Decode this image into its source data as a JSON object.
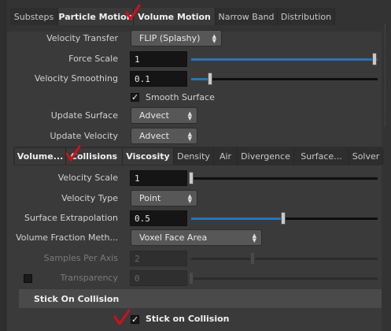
{
  "top_tabs": [
    {
      "label": "Substeps",
      "active": false
    },
    {
      "label": "Particle Motion",
      "active": true
    },
    {
      "label": "Volume Motion",
      "active": true
    },
    {
      "label": "Narrow Band",
      "active": false
    },
    {
      "label": "Distribution",
      "active": false
    }
  ],
  "particle_motion": {
    "velocity_transfer": {
      "label": "Velocity Transfer",
      "value": "FLIP (Splashy)"
    },
    "force_scale": {
      "label": "Force Scale",
      "value": "1",
      "slider_fraction": 1.0
    },
    "velocity_smoothing": {
      "label": "Velocity Smoothing",
      "value": "0.1",
      "slider_fraction": 0.1
    },
    "smooth_surface": {
      "label": "Smooth Surface",
      "checked": true
    },
    "update_surface": {
      "label": "Update Surface",
      "value": "Advect"
    },
    "update_velocity": {
      "label": "Update Velocity",
      "value": "Advect"
    }
  },
  "sub_tabs": [
    {
      "label": "Volume...",
      "active": true
    },
    {
      "label": "Collisions",
      "active": true
    },
    {
      "label": "Viscosity",
      "active": true
    },
    {
      "label": "Density",
      "active": false
    },
    {
      "label": "Air",
      "active": false
    },
    {
      "label": "Divergence",
      "active": false
    },
    {
      "label": "Surface...",
      "active": false
    },
    {
      "label": "Solver",
      "active": false
    }
  ],
  "volume_motion": {
    "velocity_scale": {
      "label": "Velocity Scale",
      "value": "1",
      "slider_fraction": 0.0
    },
    "velocity_type": {
      "label": "Velocity Type",
      "value": "Point"
    },
    "surface_extrapolation": {
      "label": "Surface Extrapolation",
      "value": "0.5",
      "slider_fraction": 0.5
    },
    "volume_fraction_method": {
      "label": "Volume Fraction Meth...",
      "value": "Voxel Face Area"
    },
    "samples_per_axis": {
      "label": "Samples Per Axis",
      "value": "2",
      "slider_fraction": 0.32
    },
    "transparency": {
      "label": "Transparency",
      "value": "0",
      "slider_fraction": 0.0,
      "checked": false
    }
  },
  "stick_on_collision_section": {
    "header": "Stick On Collision",
    "stick_on_collision": {
      "label": "Stick on Collision",
      "checked": true
    }
  },
  "annotation_color": "#d0101a"
}
